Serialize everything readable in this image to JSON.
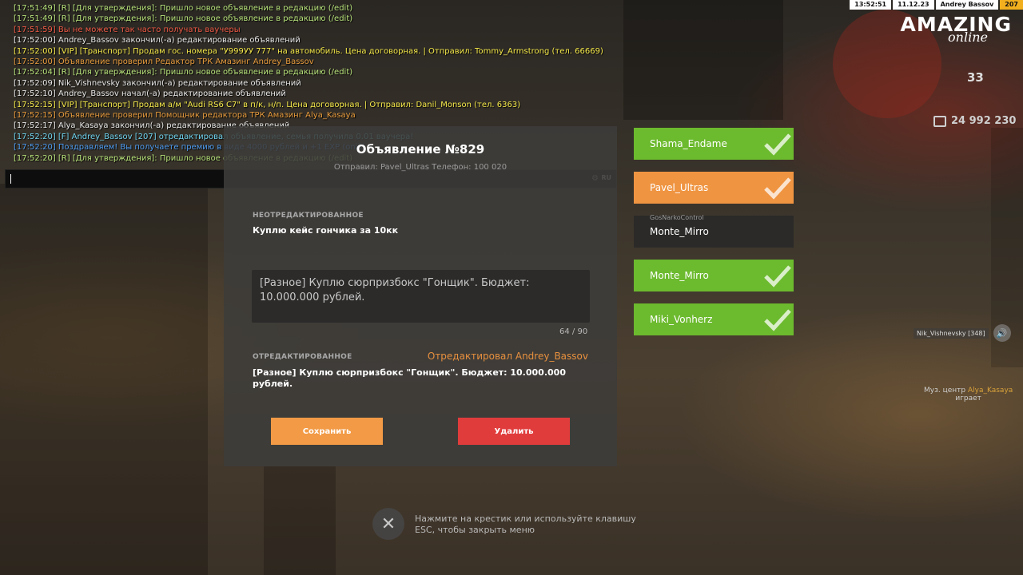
{
  "status_bar": {
    "time": "13:52:51",
    "date": "11.12.23",
    "player": "Andrey Bassov",
    "level": "207"
  },
  "logo": {
    "main": "AMAZING",
    "sub": "online"
  },
  "hud": {
    "money": "24 992 230",
    "number": "33"
  },
  "chat": [
    {
      "text": "[17:51:49] [R] [Для утверждения]: Пришло новое объявление в редакцию (/edit)",
      "color": "green"
    },
    {
      "text": "[17:51:49] [R] [Для утверждения]: Пришло новое объявление в редакцию (/edit)",
      "color": "green"
    },
    {
      "text": "[17:51:59] Вы не можете так часто получать ваучеры",
      "color": "red"
    },
    {
      "text": "[17:52:00] Andrey_Bassov закончил(-а) редактирование объявлений",
      "color": "white"
    },
    {
      "text": "[17:52:00] [VIP] [Транспорт] Продам гос. номера \"У999УУ 777\" на автомобиль. Цена договорная. | Отправил: Tommy_Armstrong (тел. 66669)",
      "color": "yellow"
    },
    {
      "text": "[17:52:00] Объявление проверил Редактор ТРК Амазинг Andrey_Bassov",
      "color": "orange"
    },
    {
      "text": "[17:52:04] [R] [Для утверждения]: Пришло новое объявление в редакцию (/edit)",
      "color": "green"
    },
    {
      "text": "[17:52:09] Nik_Vishnevsky закончил(-а) редактирование объявлений",
      "color": "white"
    },
    {
      "text": "[17:52:10] Andrey_Bassov начал(-а) редактирование объявлений",
      "color": "white"
    },
    {
      "text": "[17:52:15] [VIP] [Транспорт] Продам а/м \"Audi RS6 C7\" в п/к, н/п. Цена договорная. | Отправил: Danil_Monson (тел. 6363)",
      "color": "yellow"
    },
    {
      "text": "[17:52:15] Объявление проверил Помощник редактора ТРК Амазинг Alya_Kasaya",
      "color": "orange"
    },
    {
      "text": "[17:52:17] Alya_Kasaya закончил(-а) редактирование объявлений",
      "color": "white"
    },
    {
      "text": "[17:52:20] [F] Andrey_Bassov [207] отредактировал объявление, семья получила 0.01 ваучера!",
      "color": "cyan"
    },
    {
      "text": "[17:52:20] Поздравляем! Вы получаете премию в виде 4000 рублей и +1 EXP (oniii)",
      "color": "blue"
    },
    {
      "text": "[17:52:20] [R] [Для утверждения]: Пришло новое объявление в редакцию (/edit)",
      "color": "green"
    }
  ],
  "chat_input": {
    "lang": "RU"
  },
  "modal": {
    "title": "Объявление №829",
    "sender": "Отправил: Pavel_Ultras Телефон: 100 020",
    "original_label": "НЕОТРЕДАКТИРОВАННОЕ",
    "original_text": "Куплю кейс гончика за 10кк",
    "edit_text": "[Разное] Куплю сюрпризбокс \"Гонщик\". Бюджет: 10.000.000 рублей.",
    "counter": "64 / 90",
    "edited_label": "ОТРЕДАКТИРОВАННОЕ",
    "edited_by": "Отредактировал Andrey_Bassov",
    "edited_text": "[Разное] Куплю сюрпризбокс \"Гонщик\". Бюджет: 10.000.000 рублей.",
    "save_label": "Сохранить",
    "delete_label": "Удалить"
  },
  "editors": [
    {
      "name": "Shama_Endame",
      "state": "green",
      "checked": true
    },
    {
      "name": "Pavel_Ultras",
      "state": "orange",
      "checked": true
    },
    {
      "name": "Monte_Mirro",
      "state": "dark",
      "checked": false,
      "tag": "GosNarkoControl"
    },
    {
      "name": "Monte_Mirro",
      "state": "green",
      "checked": true
    },
    {
      "name": "Miki_Vonherz",
      "state": "green",
      "checked": true
    }
  ],
  "voice": {
    "name": "Nik_Vishnevsky [348]"
  },
  "music": {
    "line1": "Муз. центр",
    "player": "Alya_Kasaya",
    "line2": "играет"
  },
  "close_hint": {
    "icon": "close-icon",
    "text": "Нажмите на крестик или используйте клавишу ESC, чтобы закрыть меню"
  }
}
